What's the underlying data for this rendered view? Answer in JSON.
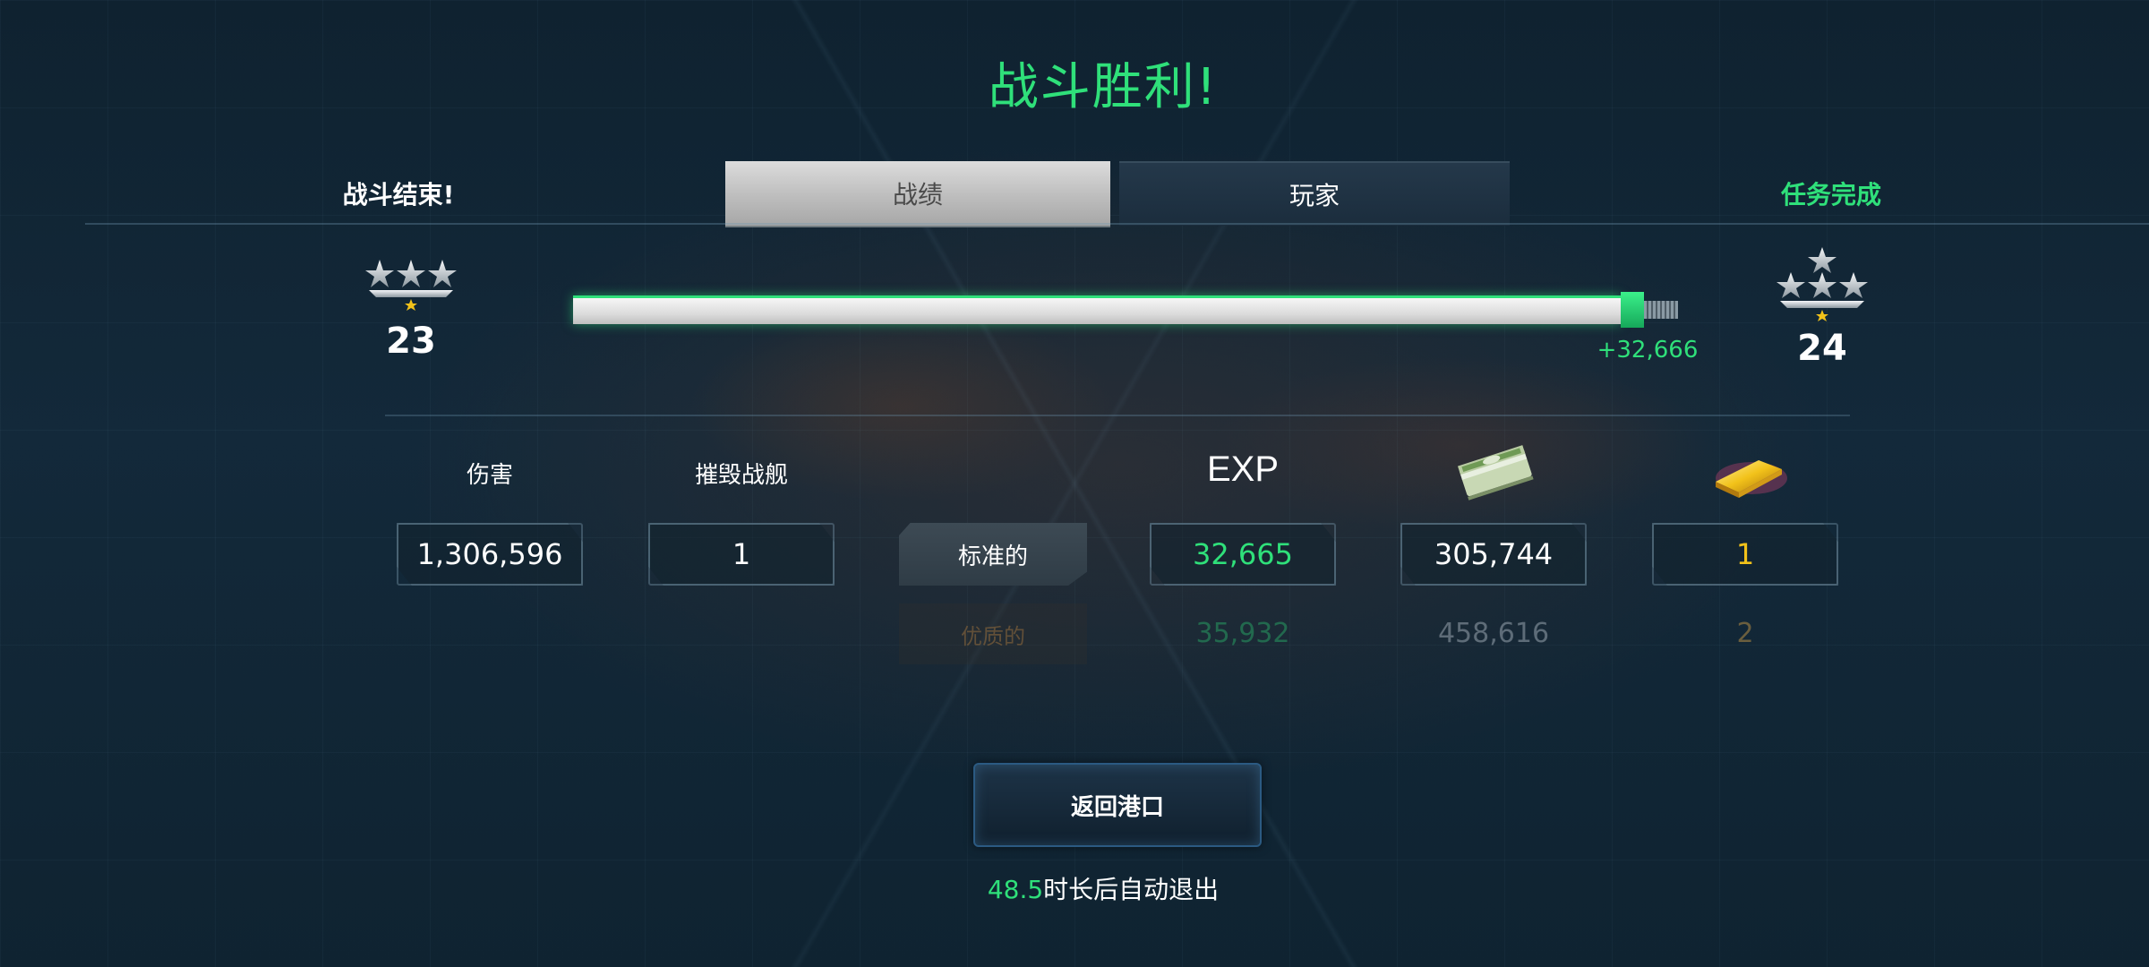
{
  "title": "战斗胜利!",
  "header": {
    "left_text": "战斗结束!",
    "right_text": "任务完成",
    "tabs": [
      {
        "label": "战绩",
        "active": true
      },
      {
        "label": "玩家",
        "active": false
      }
    ]
  },
  "progress": {
    "current_rank": "23",
    "next_rank": "24",
    "gain_text": "+32,666",
    "fill_fraction": 0.985
  },
  "stats": {
    "damage_label": "伤害",
    "damage_value": "1,306,596",
    "kills_label": "摧毁战舰",
    "kills_value": "1"
  },
  "rewards": {
    "exp_label": "EXP",
    "money_icon": "cash-stack-icon",
    "gold_icon": "gold-bar-icon",
    "standard": {
      "label": "标准的",
      "exp": "32,665",
      "money": "305,744",
      "gold": "1"
    },
    "premium": {
      "label": "优质的",
      "exp": "35,932",
      "money": "458,616",
      "gold": "2"
    }
  },
  "footer": {
    "return_button": "返回港口",
    "countdown_value": "48.5",
    "countdown_suffix": "时长后自动退出"
  },
  "colors": {
    "accent_green": "#2fe07a",
    "gold_yellow": "#f2c21a",
    "button_border": "#2b5a82"
  }
}
